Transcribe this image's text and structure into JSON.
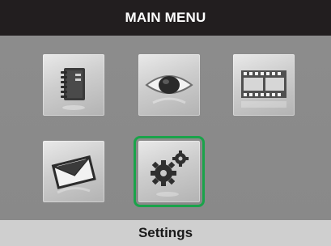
{
  "header": {
    "title": "MAIN MENU"
  },
  "menu": {
    "items": [
      {
        "id": "address-book",
        "icon": "address-book-icon"
      },
      {
        "id": "view",
        "icon": "eye-icon"
      },
      {
        "id": "video",
        "icon": "film-strip-icon"
      },
      {
        "id": "messages",
        "icon": "envelope-icon"
      },
      {
        "id": "settings",
        "icon": "gears-icon",
        "selected": true
      }
    ],
    "selected_color": "#1aa34a"
  },
  "footer": {
    "label": "Settings"
  }
}
